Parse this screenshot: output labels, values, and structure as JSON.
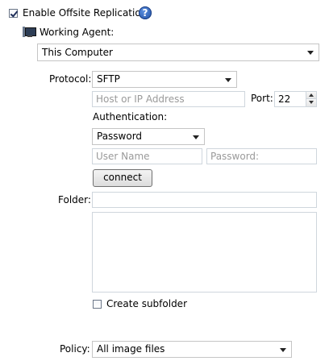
{
  "replication": {
    "enable_label": "Enable Offsite Replication",
    "enabled": true
  },
  "agent": {
    "label": "Working Agent:",
    "selected": "This Computer"
  },
  "protocol": {
    "label": "Protocol:",
    "selected": "SFTP"
  },
  "host": {
    "placeholder": "Host or IP Address"
  },
  "port": {
    "label": "Port:",
    "value": "22"
  },
  "authentication": {
    "label": "Authentication:",
    "selected": "Password"
  },
  "credentials": {
    "username_placeholder": "User Name",
    "password_placeholder": "Password:"
  },
  "connect_label": "connect",
  "folder": {
    "label": "Folder:"
  },
  "subfolder": {
    "label": "Create subfolder",
    "checked": false
  },
  "policy": {
    "label": "Policy:",
    "selected": "All image files"
  },
  "colors": {
    "help_icon": "#1f4ea0",
    "agent_icon": "#2d3d55"
  }
}
